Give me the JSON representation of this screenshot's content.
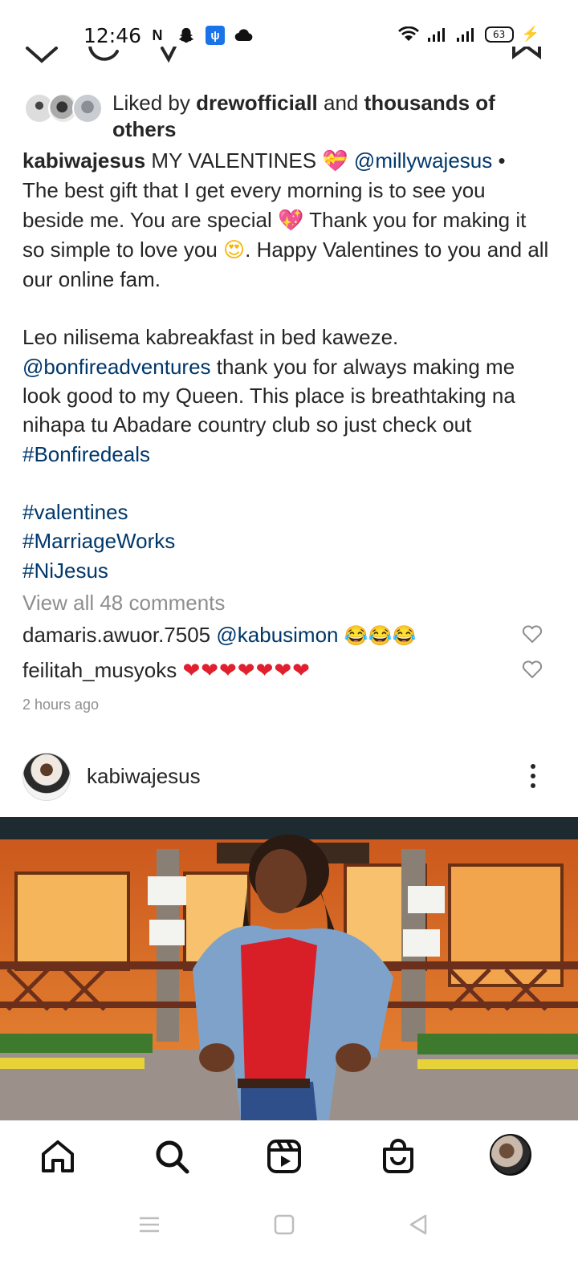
{
  "status_bar": {
    "time": "12:46",
    "battery": "63",
    "left_icons": [
      "N",
      "snapchat",
      "usb",
      "cloud"
    ],
    "right_icons": [
      "wifi-icon",
      "signal-icon",
      "signal-icon",
      "battery-icon",
      "charging-icon"
    ]
  },
  "likes": {
    "prefix": "Liked by ",
    "user": "drewofficiall",
    "middle": " and ",
    "others": "thousands of others"
  },
  "caption": {
    "username": "kabiwajesus",
    "text1": " MY VALENTINES ",
    "emoji1": "💝",
    "mention1": "@millywajesus",
    "bullet": " •",
    "text2": "The best gift that I get every morning is to see you beside me. You are special ",
    "emoji2": "💖",
    "text3": "  Thank you for making it so simple to love you ",
    "emoji3": "😍",
    "text4": ". Happy Valentines to you and all our online fam.",
    "text5": "Leo nilisema kabreakfast in bed kaweze.",
    "mention2": "@bonfireadventures",
    "text6": " thank you for always making me look good to my Queen. This place is breathtaking na nihapa tu Abadare country club so just check out",
    "hashtag1": "#Bonfiredeals",
    "hashtag2": "#valentines",
    "hashtag3": "#MarriageWorks",
    "hashtag4": "#NiJesus"
  },
  "comments": {
    "view_all": "View all 48 comments",
    "items": [
      {
        "user": "damaris.awuor.7505",
        "mention": "@kabusimon",
        "emojis": "😂😂😂"
      },
      {
        "user": "feilitah_musyoks",
        "emojis": "❤❤❤❤❤❤❤"
      }
    ]
  },
  "timestamp": "2 hours ago",
  "next_post": {
    "username": "kabiwajesus"
  },
  "colors": {
    "link": "#00376b",
    "muted": "#8e8e8e",
    "text": "#262626"
  }
}
